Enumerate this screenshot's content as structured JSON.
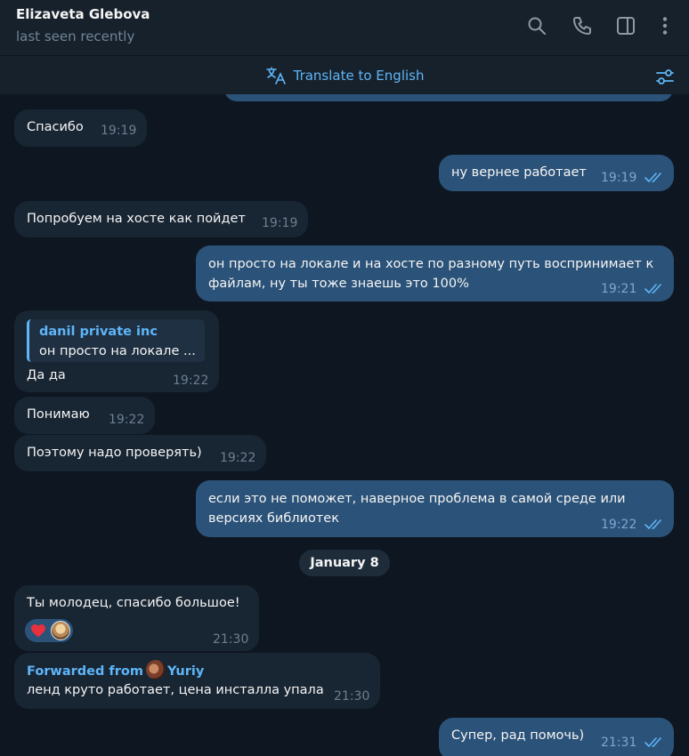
{
  "header": {
    "name": "Elizaveta Glebova",
    "status": "last seen recently"
  },
  "translate_bar": {
    "label": "Translate to English"
  },
  "date_separator": "January 8",
  "messages": [
    {
      "direction": "in",
      "text": "Спасибо",
      "time": "19:19"
    },
    {
      "direction": "out",
      "text": "ну вернее работает",
      "time": "19:19",
      "read": true
    },
    {
      "direction": "in",
      "text": "Попробуем на хосте как пойдет",
      "time": "19:19"
    },
    {
      "direction": "out",
      "line1": "он просто на локале и на хосте по разному путь воспринимает к",
      "line2": "файлам, ну ты тоже знаешь это 100%",
      "time": "19:21",
      "read": true
    },
    {
      "direction": "in",
      "reply_name": "danil private inc",
      "reply_text": "он просто на локале ...",
      "text": "Да да",
      "time": "19:22"
    },
    {
      "direction": "in",
      "text": "Понимаю",
      "time": "19:22"
    },
    {
      "direction": "in",
      "text": "Поэтому надо проверять)",
      "time": "19:22"
    },
    {
      "direction": "out",
      "line1": "если это не поможет, наверное проблема в самой среде или",
      "line2": "версиях библиотек",
      "time": "19:22",
      "read": true
    },
    {
      "direction": "in",
      "text": "Ты молодец, спасибо большое!",
      "time": "21:30",
      "reactions": [
        "heart",
        "avatar"
      ]
    },
    {
      "direction": "in",
      "forwarded_prefix": "Forwarded from",
      "forwarded_name": "Yuriy",
      "text": "ленд круто работает, цена инсталла упала",
      "time": "21:30"
    },
    {
      "direction": "out",
      "text": "Супер, рад помочь)",
      "time": "21:31",
      "read": true
    }
  ],
  "colors": {
    "background": "#0e1621",
    "header": "#17212b",
    "incoming_bubble": "#182533",
    "outgoing_bubble": "#2b5278",
    "accent": "#5eb5f7"
  },
  "icons": [
    "search-icon",
    "phone-icon",
    "sidebar-toggle-icon",
    "more-vert-icon",
    "translate-icon",
    "filter-settings-icon",
    "double-check-icon"
  ]
}
